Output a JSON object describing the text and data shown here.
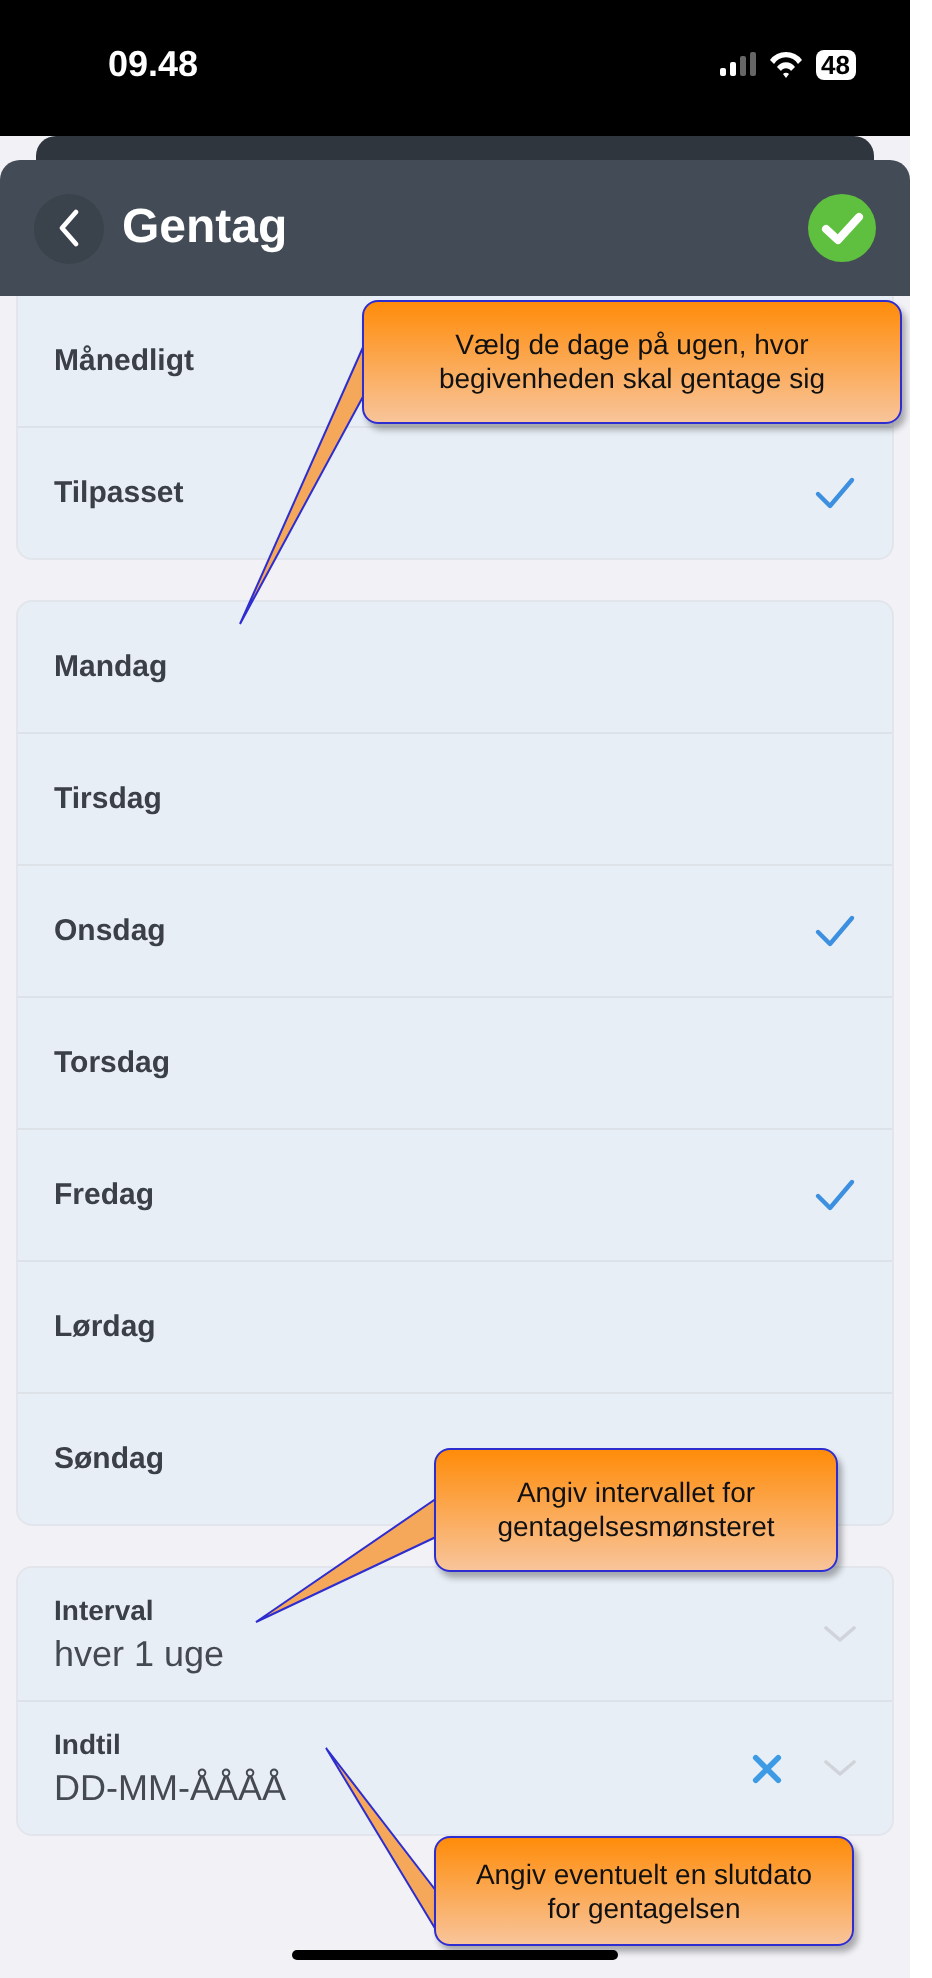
{
  "status_bar": {
    "time": "09.48",
    "battery": "48"
  },
  "header": {
    "title": "Gentag"
  },
  "groups": [
    {
      "rows": [
        {
          "label": "Månedligt",
          "selected": false
        },
        {
          "label": "Tilpasset",
          "selected": true
        }
      ]
    },
    {
      "rows": [
        {
          "label": "Mandag",
          "selected": false
        },
        {
          "label": "Tirsdag",
          "selected": false
        },
        {
          "label": "Onsdag",
          "selected": true
        },
        {
          "label": "Torsdag",
          "selected": false
        },
        {
          "label": "Fredag",
          "selected": true
        },
        {
          "label": "Lørdag",
          "selected": false
        },
        {
          "label": "Søndag",
          "selected": false
        }
      ]
    }
  ],
  "fields": [
    {
      "label": "Interval",
      "value": "hver 1 uge",
      "clearable": false
    },
    {
      "label": "Indtil",
      "value": "DD-MM-ÅÅÅÅ",
      "clearable": true
    }
  ],
  "callouts": [
    {
      "text": "Vælg de dage på ugen, hvor begivenheden skal gentage sig"
    },
    {
      "text": "Angiv intervallet for gentagelsesmønsteret"
    },
    {
      "text": "Angiv eventuelt en slutdato for gentagelsen"
    }
  ]
}
